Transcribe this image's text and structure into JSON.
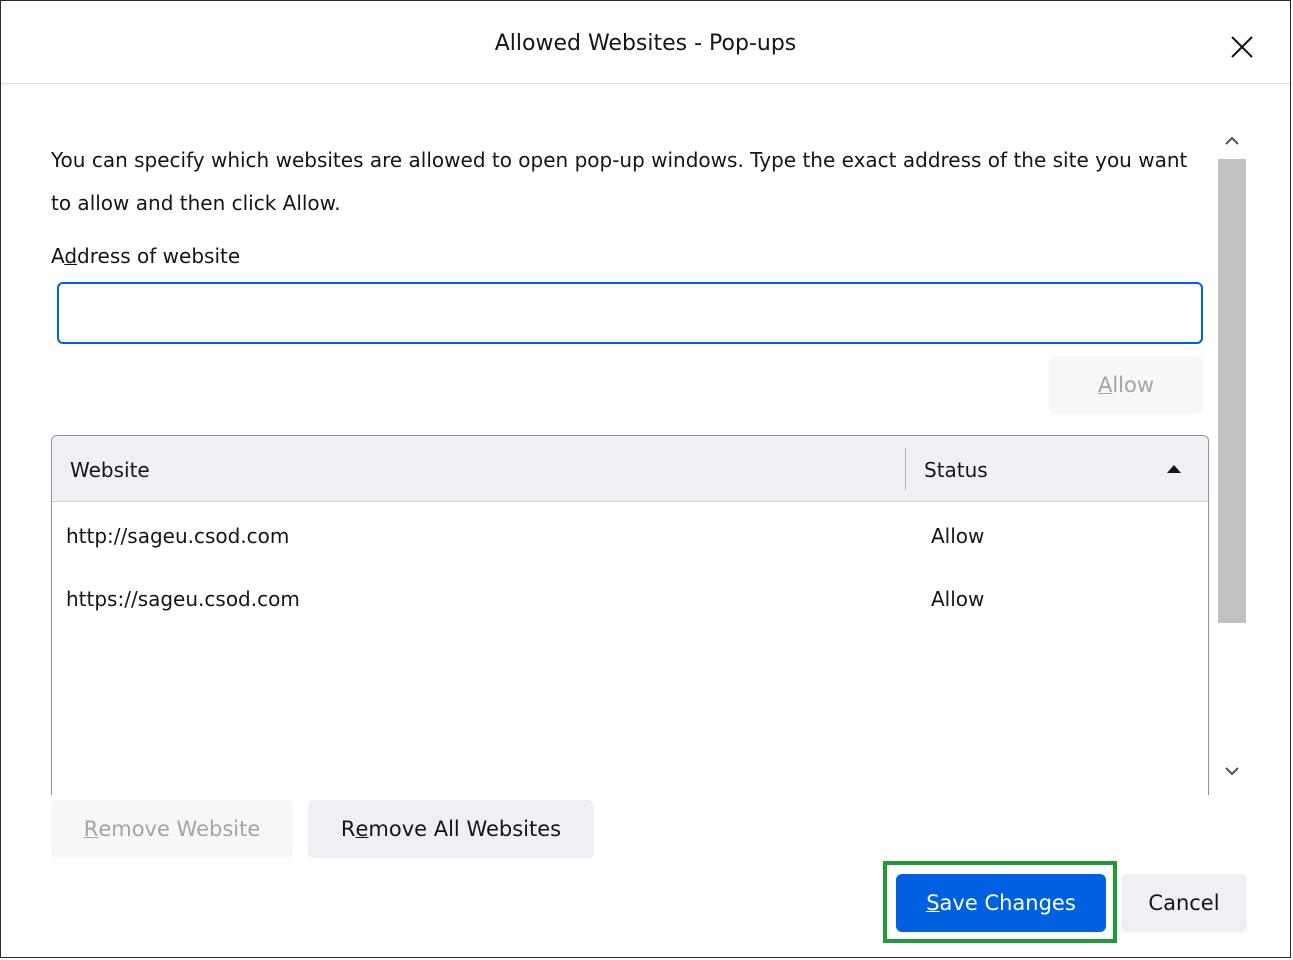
{
  "dialog": {
    "title": "Allowed Websites - Pop-ups",
    "close_icon": "close-icon"
  },
  "description": "You can specify which websites are allowed to open pop-up windows. Type the exact address of the site you want to allow and then click Allow.",
  "address": {
    "label_prefix": "A",
    "label_accel": "d",
    "label_suffix": "dress of website",
    "value": "",
    "placeholder": ""
  },
  "allow_button": {
    "accel": "A",
    "rest": "llow"
  },
  "table": {
    "headers": {
      "website": "Website",
      "status": "Status"
    },
    "sort_icon": "sort-ascending-icon",
    "rows": [
      {
        "website": "http://sageu.csod.com",
        "status": "Allow"
      },
      {
        "website": "https://sageu.csod.com",
        "status": "Allow"
      }
    ]
  },
  "scrollbar": {
    "up_icon": "chevron-up-icon",
    "down_icon": "chevron-down-icon"
  },
  "remove_website": {
    "accel": "R",
    "rest": "emove Website"
  },
  "remove_all": {
    "prefix": "R",
    "accel": "e",
    "rest": "move All Websites"
  },
  "save_changes": {
    "accel": "S",
    "rest": "ave Changes"
  },
  "cancel": {
    "label": "Cancel"
  },
  "colors": {
    "accent": "#0061e0",
    "highlight": "#1e9b36",
    "disabled_text": "#a4a4a8"
  }
}
